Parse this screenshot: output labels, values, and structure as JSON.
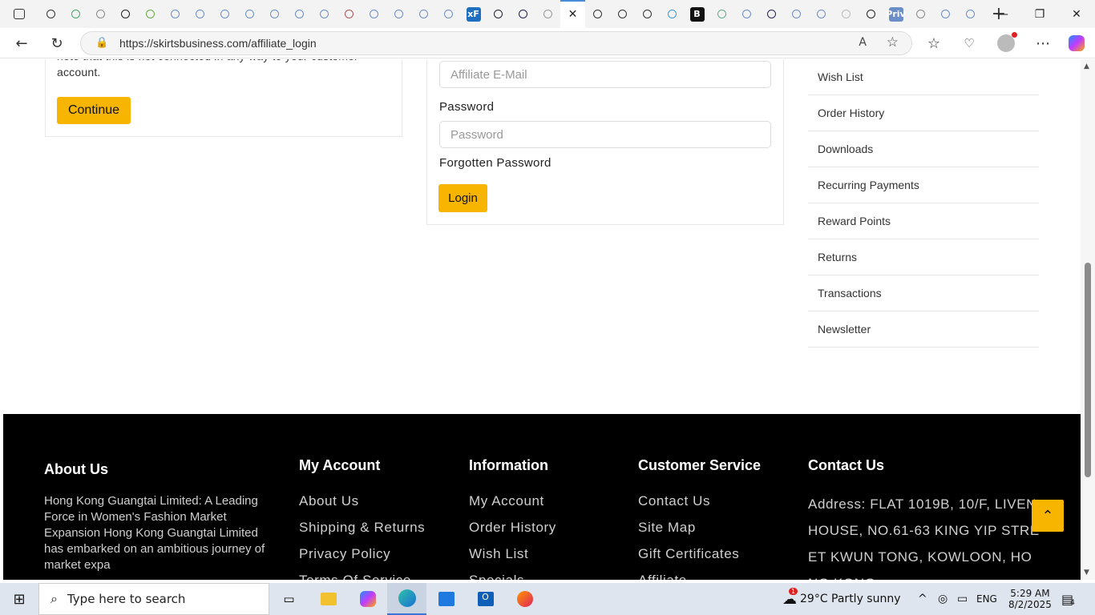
{
  "browser": {
    "tabs": [
      "",
      "",
      "",
      "",
      "",
      "",
      "",
      "",
      "",
      "",
      "",
      "",
      "",
      "",
      "",
      "",
      "",
      "xF",
      "",
      "",
      "",
      "",
      "",
      "",
      "",
      "",
      "B",
      "",
      "",
      "",
      "",
      "",
      "",
      "",
      "Priv",
      "",
      "",
      ""
    ],
    "url": "https://skirtsbusiness.com/affiliate_login"
  },
  "new_customer": {
    "note": "note that this is not connected in any way to your customer account.",
    "continue_label": "Continue"
  },
  "login_form": {
    "email_placeholder": "Affiliate E-Mail",
    "password_label": "Password",
    "password_placeholder": "Password",
    "forgotten_label": "Forgotten Password",
    "login_label": "Login"
  },
  "sidebar": {
    "items": [
      "Wish List",
      "Order History",
      "Downloads",
      "Recurring Payments",
      "Reward Points",
      "Returns",
      "Transactions",
      "Newsletter"
    ]
  },
  "footer": {
    "about": {
      "title": "About Us",
      "text": "Hong Kong Guangtai Limited: A Leading Force in Women's Fashion Market Expansion Hong Kong Guangtai Limited has embarked on an ambitious journey of market expa"
    },
    "my_account": {
      "title": "My Account",
      "links": [
        "About Us",
        "Shipping & Returns",
        "Privacy Policy",
        "Terms Of Service"
      ]
    },
    "information": {
      "title": "Information",
      "links": [
        "My Account",
        "Order History",
        "Wish List",
        "Specials"
      ]
    },
    "customer_service": {
      "title": "Customer Service",
      "links": [
        "Contact Us",
        "Site Map",
        "Gift Certificates",
        "Affiliate"
      ]
    },
    "contact": {
      "title": "Contact Us",
      "address": "Address: FLAT 1019B, 10/F, LIVEN HOUSE, NO.61-63 KING YIP STREET KWUN TONG, KOWLOON, HONG KONG"
    }
  },
  "taskbar": {
    "search_placeholder": "Type here to search",
    "weather": "29°C  Partly sunny",
    "weather_badge": "1",
    "language": "ENG",
    "time": "5:29 AM",
    "date": "8/2/2025",
    "notifications": "4"
  }
}
